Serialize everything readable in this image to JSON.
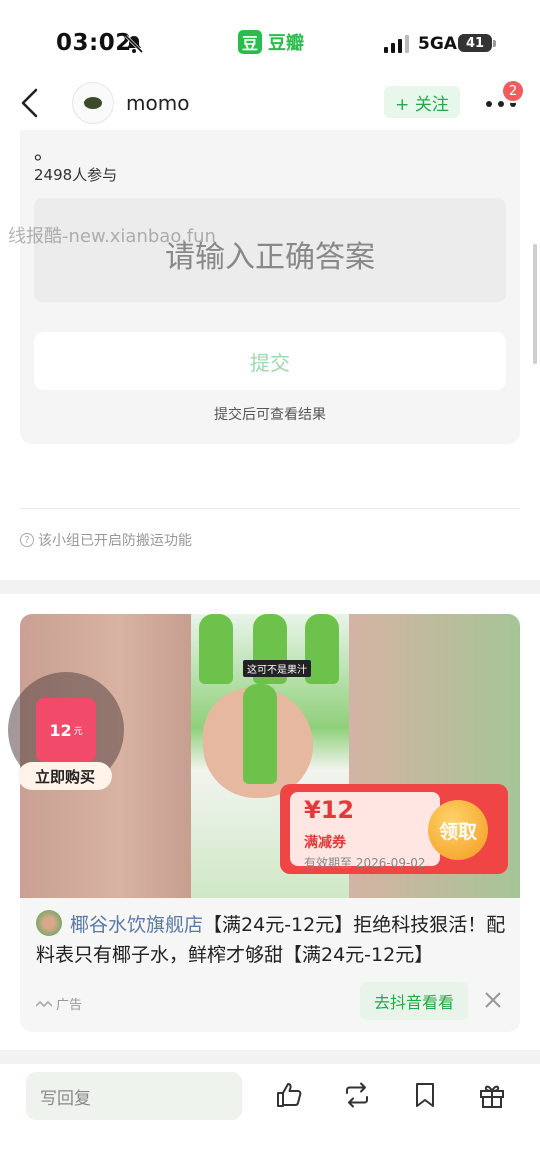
{
  "status": {
    "time": "03:02",
    "app_name": "豆瓣",
    "app_logo_char": "豆",
    "network": "5GA",
    "battery": "41"
  },
  "nav": {
    "username": "momo",
    "follow_label": "+ 关注",
    "notification_count": "2"
  },
  "poll": {
    "dot": "。",
    "participants": "2498人参与",
    "answer_placeholder": "请输入正确答案",
    "submit_label": "提交",
    "submit_hint": "提交后可查看结果"
  },
  "watermark": "线报酷-new.xianbao.fun",
  "protect_notice": "该小组已开启防搬运功能",
  "protect_icon": "?",
  "ad": {
    "video_caption": "这可不是果汁",
    "buy_price": "12",
    "buy_unit": "元",
    "buy_label": "立即购买",
    "coupon_amount": "¥12",
    "coupon_type": "满减券",
    "coupon_expiry": "有效期至 2026-09-02",
    "coupon_button": "领取",
    "shop_name": "椰谷水饮旗舰店",
    "title": "【满24元-12元】拒绝科技狠活！配料表只有椰子水，鲜榨才够甜【满24元-12元】",
    "tag": "广告",
    "goto_label": "去抖音看看"
  },
  "bottom": {
    "reply_placeholder": "写回复"
  },
  "colors": {
    "brand_green": "#2bbd4c",
    "coupon_red": "#f04545",
    "badge_red": "#f25c5c"
  }
}
